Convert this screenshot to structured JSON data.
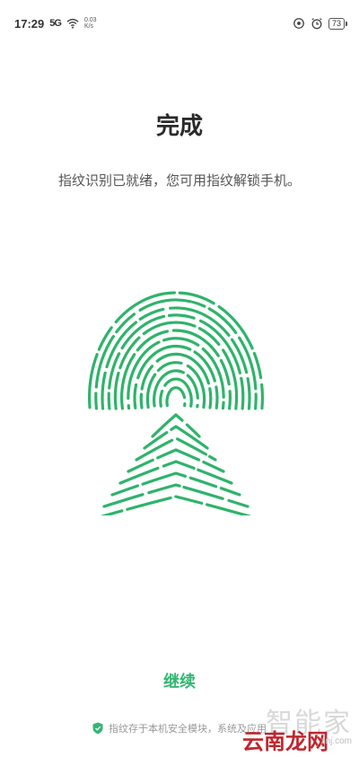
{
  "status_bar": {
    "time": "17:29",
    "signal": "5G",
    "network_line1": "0.03",
    "network_line2": "K/s",
    "battery": "73"
  },
  "page": {
    "title": "完成",
    "subtitle": "指纹识别已就绪，您可用指纹解锁手机。"
  },
  "actions": {
    "continue_label": "继续"
  },
  "footer": {
    "note": "指纹存于本机安全模块，系统及应用"
  },
  "watermark": {
    "top": "智能家",
    "bottom": "云南龙网",
    "url": "znj.com"
  },
  "colors": {
    "accent": "#34b672",
    "fingerprint": "#2fb36b"
  },
  "icons": {
    "fingerprint": "fingerprint-icon",
    "shield": "shield-icon"
  }
}
